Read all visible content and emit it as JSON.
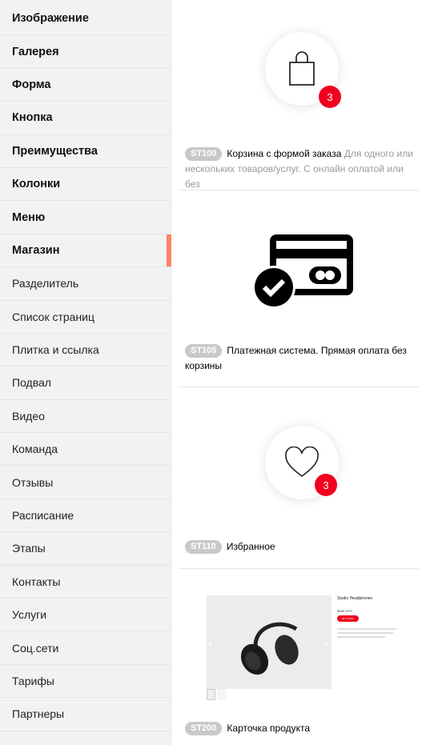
{
  "sidebar": {
    "items": [
      {
        "label": "Изображение",
        "bold": true
      },
      {
        "label": "Галерея",
        "bold": true
      },
      {
        "label": "Форма",
        "bold": true
      },
      {
        "label": "Кнопка",
        "bold": true
      },
      {
        "label": "Преимущества",
        "bold": true
      },
      {
        "label": "Колонки",
        "bold": true
      },
      {
        "label": "Меню",
        "bold": true
      },
      {
        "label": "Магазин",
        "bold": true,
        "active": true
      },
      {
        "label": "Разделитель",
        "bold": false
      },
      {
        "label": "Список страниц",
        "bold": false
      },
      {
        "label": "Плитка и ссылка",
        "bold": false
      },
      {
        "label": "Подвал",
        "bold": false
      },
      {
        "label": "Видео",
        "bold": false
      },
      {
        "label": "Команда",
        "bold": false
      },
      {
        "label": "Отзывы",
        "bold": false
      },
      {
        "label": "Расписание",
        "bold": false
      },
      {
        "label": "Этапы",
        "bold": false
      },
      {
        "label": "Контакты",
        "bold": false
      },
      {
        "label": "Услуги",
        "bold": false
      },
      {
        "label": "Соц.сети",
        "bold": false
      },
      {
        "label": "Тарифы",
        "bold": false
      },
      {
        "label": "Партнеры",
        "bold": false
      }
    ],
    "accent_color": "#ff8562"
  },
  "blocks": [
    {
      "code": "ST100",
      "title": "Корзина с формой заказа",
      "description": "Для одного или нескольких товаров/услуг. С онлайн оплатой или без",
      "counter": "3",
      "icon": "shopping-bag-icon"
    },
    {
      "code": "ST105",
      "title": "Платежная система. Прямая оплата без корзины",
      "description": "",
      "icon": "payment-card-check-icon"
    },
    {
      "code": "ST110",
      "title": "Избранное",
      "description": "",
      "counter": "3",
      "icon": "heart-icon"
    },
    {
      "code": "ST200",
      "title": "Карточка продукта",
      "description": "",
      "icon": "product-card-preview",
      "preview": {
        "product_name": "Studio Headphones",
        "price": "$159",
        "old_price": "$200",
        "button": "BUY NOW"
      }
    }
  ],
  "colors": {
    "counter_red": "#f2001f",
    "badge_gray": "#c9c9c9"
  }
}
